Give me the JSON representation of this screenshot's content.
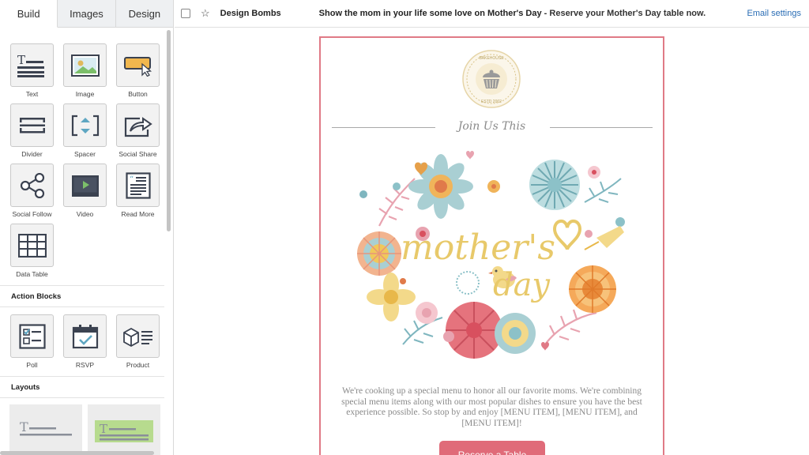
{
  "tabs": [
    {
      "label": "Build",
      "active": true
    },
    {
      "label": "Images",
      "active": false
    },
    {
      "label": "Design",
      "active": false
    }
  ],
  "content_blocks": [
    {
      "label": "Text",
      "icon": "text-icon"
    },
    {
      "label": "Image",
      "icon": "image-icon"
    },
    {
      "label": "Button",
      "icon": "button-icon"
    },
    {
      "label": "Divider",
      "icon": "divider-icon"
    },
    {
      "label": "Spacer",
      "icon": "spacer-icon"
    },
    {
      "label": "Social Share",
      "icon": "social-share-icon"
    },
    {
      "label": "Social Follow",
      "icon": "social-follow-icon"
    },
    {
      "label": "Video",
      "icon": "video-icon"
    },
    {
      "label": "Read More",
      "icon": "read-more-icon"
    },
    {
      "label": "Data Table",
      "icon": "data-table-icon"
    }
  ],
  "action_blocks": {
    "title": "Action Blocks",
    "items": [
      {
        "label": "Poll",
        "icon": "poll-icon"
      },
      {
        "label": "RSVP",
        "icon": "rsvp-icon"
      },
      {
        "label": "Product",
        "icon": "product-icon"
      }
    ]
  },
  "layouts": {
    "title": "Layouts"
  },
  "topbar": {
    "sender": "Design Bombs",
    "subject": "Show the mom in your life some love on Mother's Day",
    "preheader": " - Reserve your Mother's Day table now.",
    "email_settings": "Email settings"
  },
  "email": {
    "heading": "Join Us This",
    "body": "We're cooking up a special menu to honor all our favorite moms. We're combining special menu items along with our most popular dishes to ensure you have the best experience possible. So stop by and enjoy [MENU ITEM], [MENU ITEM], and [MENU ITEM]!",
    "cta_label": "Reserve a Table",
    "hero_title_line1": "mother's",
    "hero_title_line2": "day",
    "logo_top_text": "BAKEHOUSE",
    "logo_bottom_text": "ESTD 2002"
  },
  "colors": {
    "accent_link": "#2a6db5",
    "email_border": "#e07a86",
    "cta": "#e06b79",
    "hero_gold": "#e8c96a"
  }
}
